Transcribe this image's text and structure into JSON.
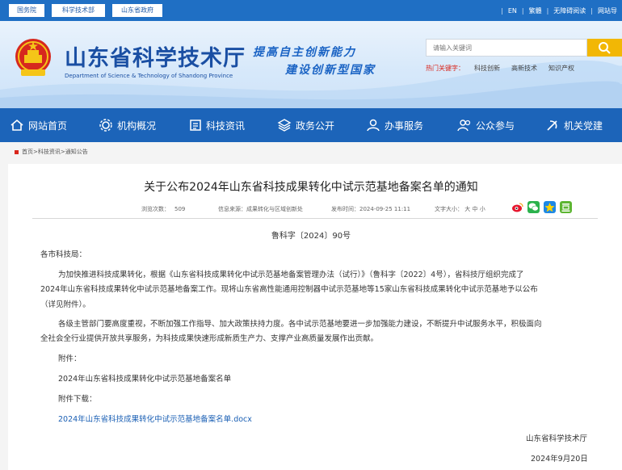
{
  "topbar": {
    "site_links": [
      "国务院",
      "科学技术部",
      "山东省政府"
    ],
    "en": "EN",
    "traditional": "繁體",
    "accessibility": "无障碍阅读",
    "nav_link": "网站导"
  },
  "header": {
    "title_cn": "山东省科学技术厅",
    "title_en": "Department of Science & Technology of Shandong Province",
    "slogan_line1": "提高自主创新能力",
    "slogan_line2": "建设创新型国家",
    "search_placeholder": "请输入关键词",
    "hot_label": "热门关键字：",
    "hot_keywords": [
      "科技创新",
      "高新技术",
      "知识产权"
    ]
  },
  "nav": {
    "items": [
      "网站首页",
      "机构概况",
      "科技资讯",
      "政务公开",
      "办事服务",
      "公众参与",
      "机关党建"
    ]
  },
  "breadcrumb": {
    "home": "首页",
    "level1": "科技资讯",
    "level2": "通知公告",
    "separator": ">"
  },
  "article": {
    "title": "关于公布2024年山东省科技成果转化中试示范基地备案名单的通知",
    "views_label": "浏览次数：",
    "views": "509",
    "source_label": "信息来源：",
    "source": "成果转化与区域创新处",
    "date_label": "发布时间：",
    "publish_time": "2024-09-25 11:11",
    "fontsize_label": "文字大小：",
    "font_large": "大",
    "font_medium": "中",
    "font_small": "小",
    "doc_number": "鲁科字〔2024〕90号",
    "salutation": "各市科技局：",
    "para1_line1": "为加快推进科技成果转化，根据《山东省科技成果转化中试示范基地备案管理办法（试行）》（鲁科字〔2022〕4号），省科技厅组织完成了",
    "para1_line2": "2024年山东省科技成果转化中试示范基地备案工作。现将山东省高性能通用控制器中试示范基地等15家山东省科技成果转化中试示范基地予以公布",
    "para1_line3": "（详见附件）。",
    "para2_line1": "各级主管部门要高度重视，不断加强工作指导、加大政策扶持力度。各中试示范基地要进一步加强能力建设，不断提升中试服务水平，积极面向",
    "para2_line2": "全社会全行业提供开放共享服务，为科技成果快速形成新质生产力、支撑产业高质量发展作出贡献。",
    "attachment_label": "附件：",
    "attachment_name": "2024年山东省科技成果转化中试示范基地备案名单",
    "download_label": "附件下载：",
    "download_link": "2024年山东省科技成果转化中试示范基地备案名单.docx",
    "signature": "山东省科学技术厅",
    "sign_date": "2024年9月20日"
  },
  "colors": {
    "primary_blue": "#1c64b9",
    "topbar_blue": "#1f6fc4",
    "search_yellow": "#f2b705",
    "hot_red": "#d9261c"
  }
}
